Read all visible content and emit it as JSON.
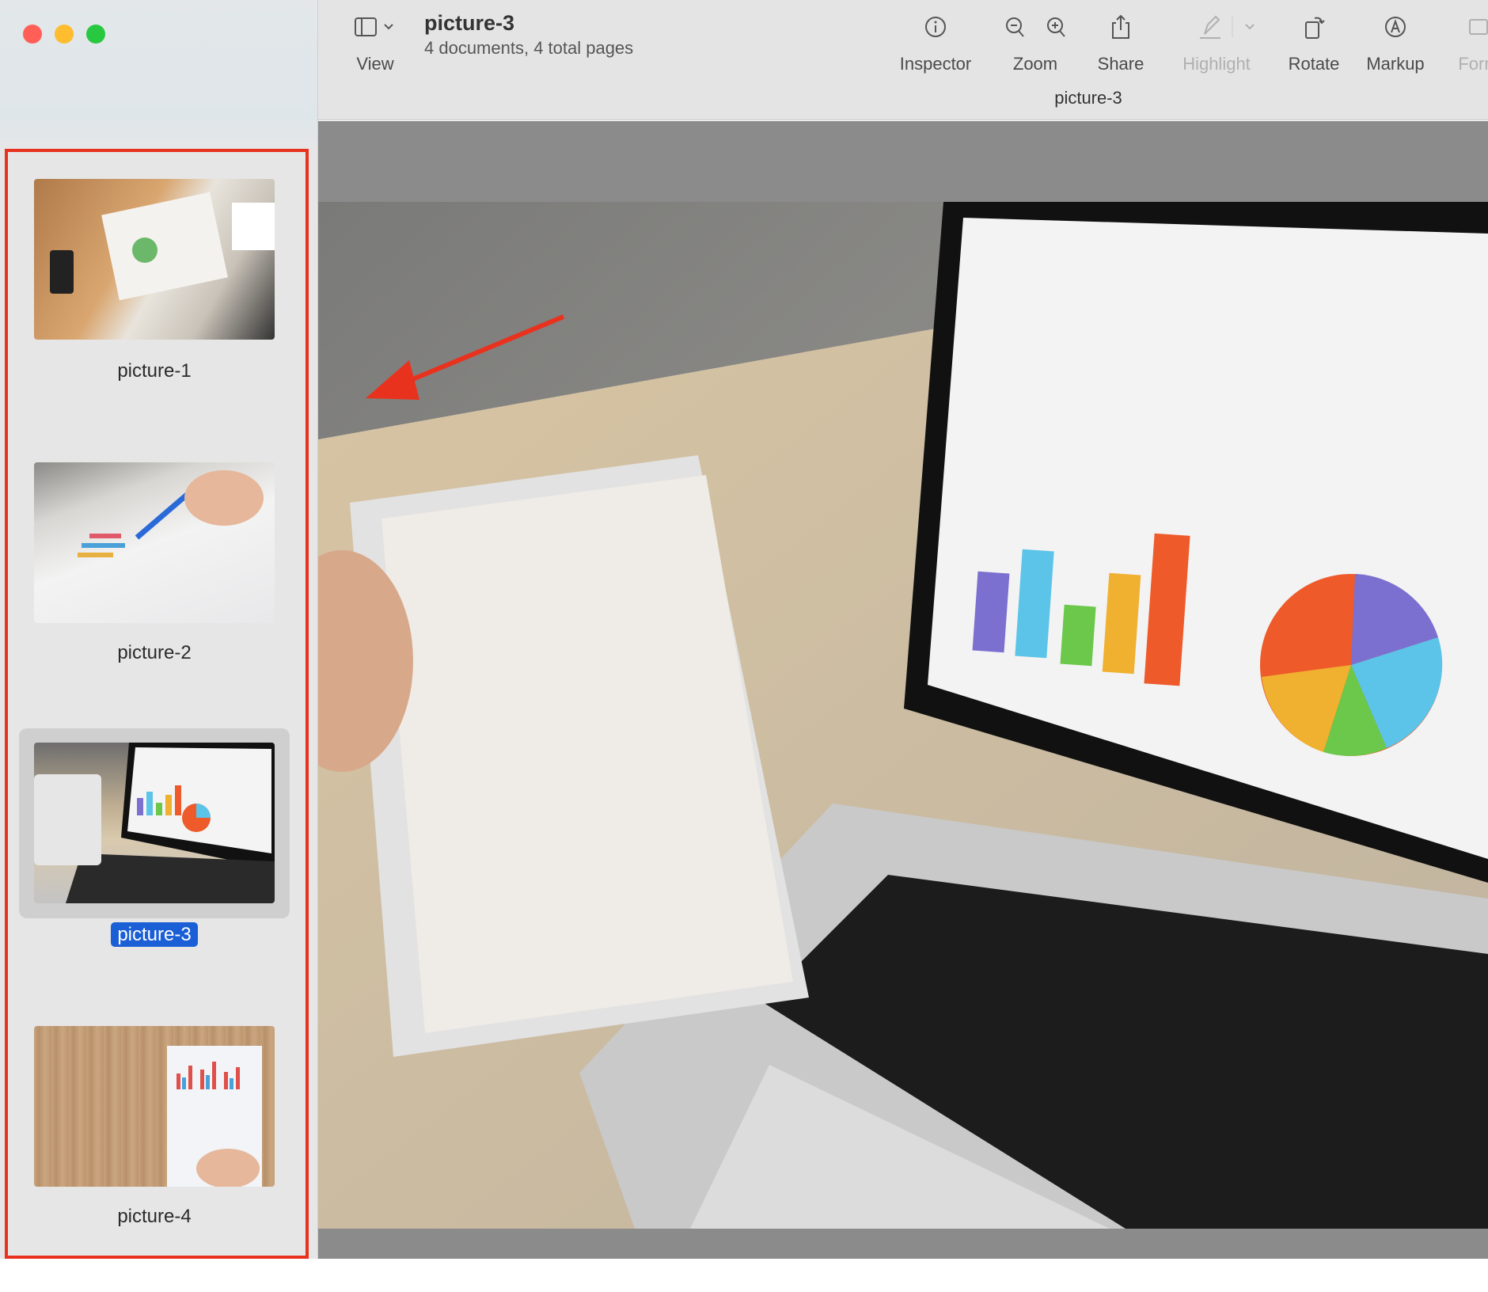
{
  "window": {
    "controls": {
      "close_color": "#ff5f57",
      "minimize_color": "#febc2e",
      "zoom_color": "#28c840"
    }
  },
  "toolbar": {
    "view_label": "View",
    "title": "picture-3",
    "subtitle": "4 documents, 4 total pages",
    "inspector_label": "Inspector",
    "zoom_label": "Zoom",
    "share_label": "Share",
    "highlight_label": "Highlight",
    "rotate_label": "Rotate",
    "markup_label": "Markup",
    "form_label": "Form",
    "document_title": "picture-3"
  },
  "sidebar": {
    "items": [
      {
        "label": "picture-1",
        "selected": false
      },
      {
        "label": "picture-2",
        "selected": false
      },
      {
        "label": "picture-3",
        "selected": true
      },
      {
        "label": "picture-4",
        "selected": false
      }
    ],
    "annotation_color": "#e8321e",
    "selection_color": "#1a5fd6"
  }
}
